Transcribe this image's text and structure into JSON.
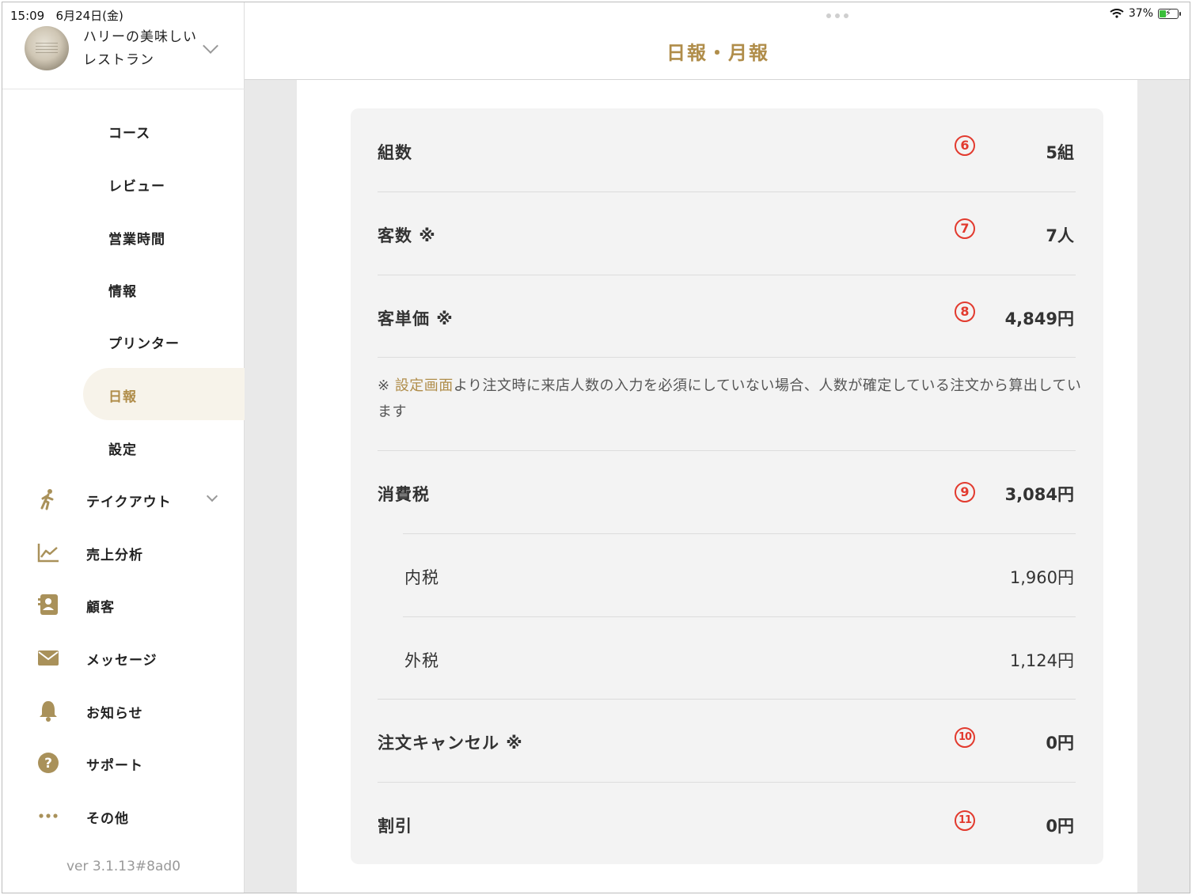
{
  "status_bar": {
    "time": "15:09",
    "date": "6月24日(金)",
    "battery": "37%",
    "battery_level": 0.37
  },
  "sidebar": {
    "store_name": "ハリーの美味しいレストラン",
    "submenu": [
      {
        "label": "コース"
      },
      {
        "label": "レビュー"
      },
      {
        "label": "営業時間"
      },
      {
        "label": "情報"
      },
      {
        "label": "プリンター"
      },
      {
        "label": "日報",
        "active": true
      },
      {
        "label": "設定"
      }
    ],
    "menu": [
      {
        "label": "テイクアウト",
        "icon": "walking-person-icon"
      },
      {
        "label": "売上分析",
        "icon": "line-chart-icon"
      },
      {
        "label": "顧客",
        "icon": "contact-book-icon"
      },
      {
        "label": "メッセージ",
        "icon": "envelope-icon"
      },
      {
        "label": "お知らせ",
        "icon": "bell-icon"
      },
      {
        "label": "サポート",
        "icon": "question-circle-icon"
      },
      {
        "label": "その他",
        "icon": "more-dots-icon"
      }
    ],
    "version": "ver 3.1.13#8ad0"
  },
  "header": {
    "title": "日報・月報"
  },
  "report": {
    "rows": [
      {
        "label": "組数",
        "marker": "6",
        "value": "5組"
      },
      {
        "label": "客数 ※",
        "marker": "7",
        "value": "7人"
      },
      {
        "label": "客単価 ※",
        "marker": "8",
        "value": "4,849円"
      },
      {
        "label": "消費税",
        "marker": "9",
        "value": "3,084円"
      },
      {
        "label": "内税",
        "value": "1,960円"
      },
      {
        "label": "外税",
        "value": "1,124円"
      },
      {
        "label": "注文キャンセル ※",
        "marker": "10",
        "value": "0円"
      },
      {
        "label": "割引",
        "marker": "11",
        "value": "0円"
      }
    ],
    "note_prefix": "※ ",
    "note_link": "設定画面",
    "note_text": "より注文時に来店人数の入力を必須にしていない場合、人数が確定している注文から算出しています"
  },
  "colors": {
    "accent": "#b08d4a",
    "marker": "#e23a2e"
  }
}
